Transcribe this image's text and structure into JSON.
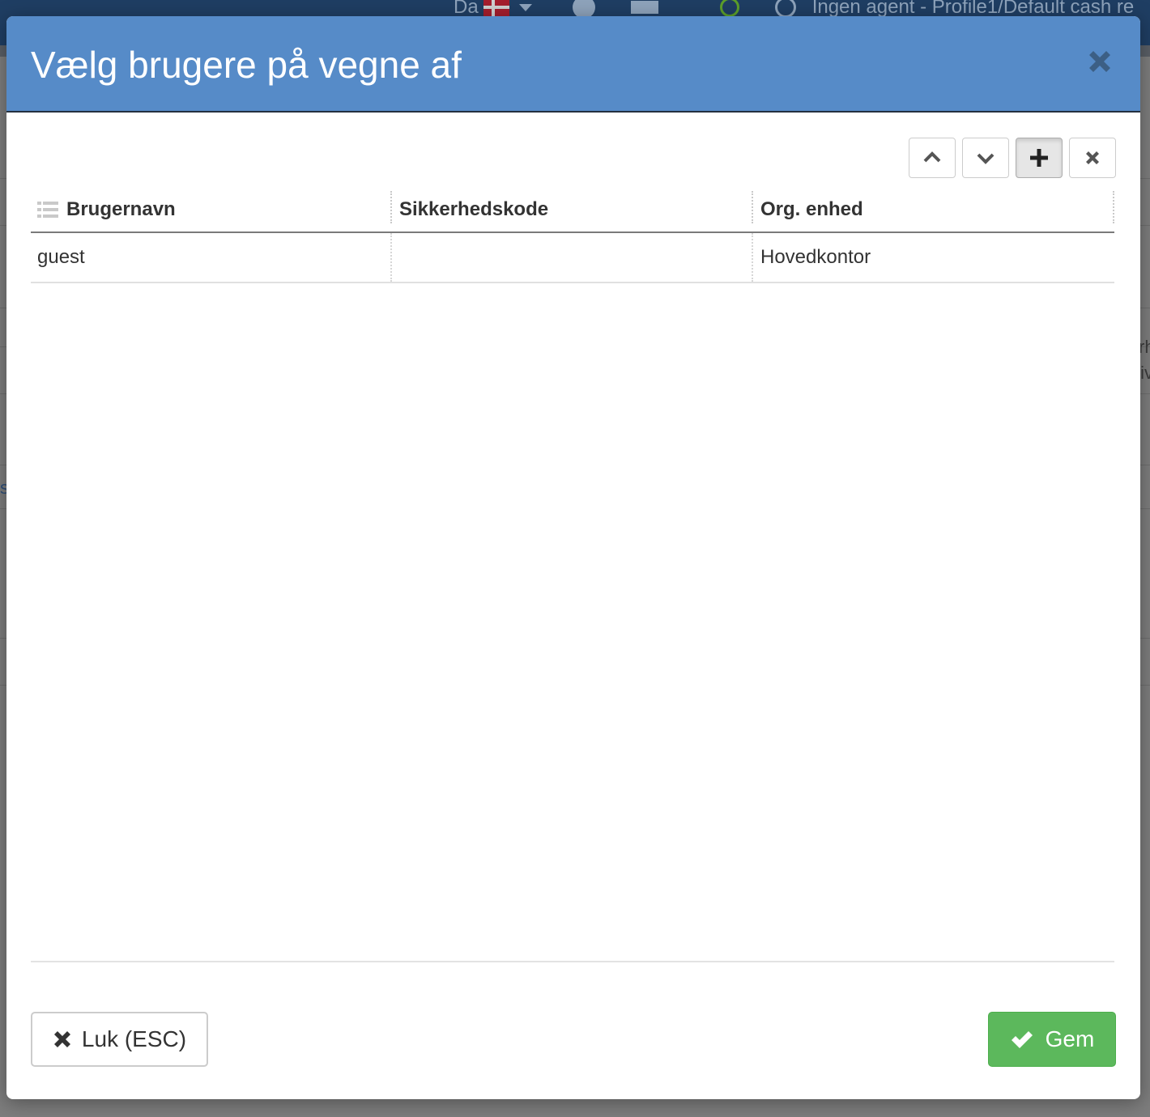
{
  "background": {
    "language": "Da",
    "agent_status": "Ingen agent - Profile1/Default cash re",
    "side_fragment_1": "rh",
    "side_fragment_2": "tiv",
    "side_fragment_3": "s"
  },
  "modal": {
    "title": "Vælg brugere på vegne af",
    "close_icon": "close-icon"
  },
  "toolbar": {
    "buttons": [
      {
        "icon": "chevron-up-icon"
      },
      {
        "icon": "chevron-down-icon"
      },
      {
        "icon": "plus-icon"
      },
      {
        "icon": "remove-icon"
      }
    ]
  },
  "grid": {
    "columns": [
      "Brugernavn",
      "Sikkerhedskode",
      "Org. enhed"
    ],
    "rows": [
      {
        "brugernavn": "guest",
        "sikkerhedskode": "",
        "org_enhed": "Hovedkontor"
      }
    ]
  },
  "footer": {
    "close_label": "Luk (ESC)",
    "save_label": "Gem"
  },
  "colors": {
    "header_bg": "#568bc8",
    "save_bg": "#5cb85c"
  }
}
